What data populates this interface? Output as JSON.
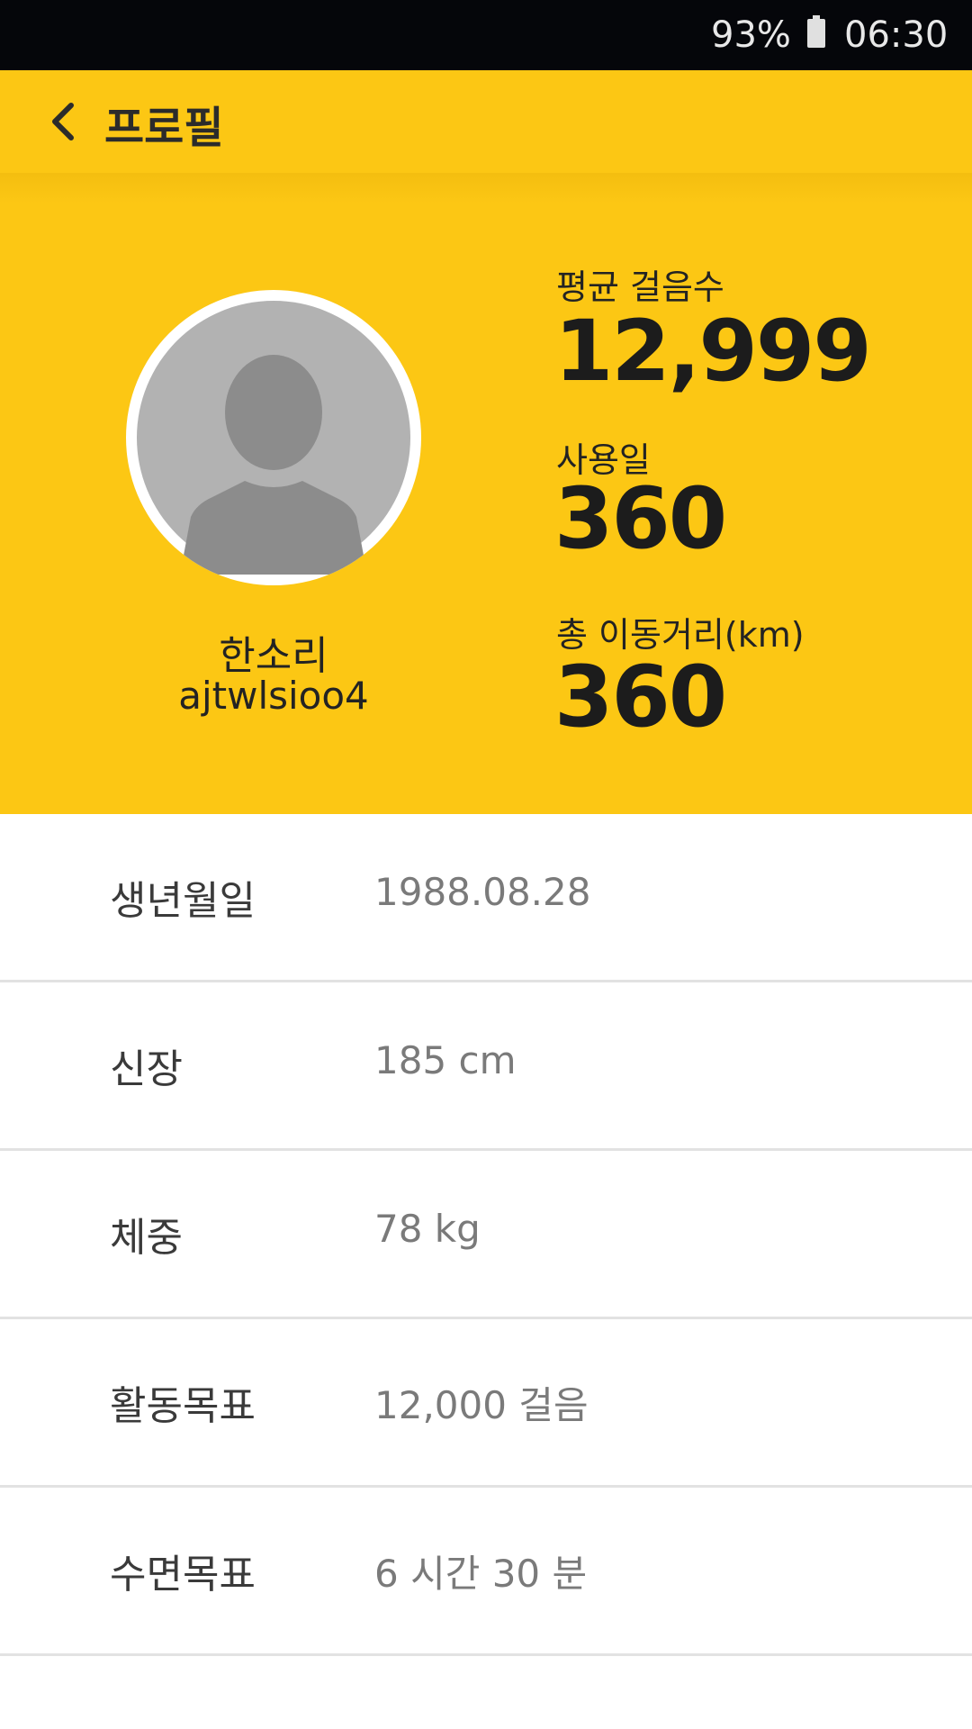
{
  "status_bar": {
    "battery": "93%",
    "battery_icon": "battery-icon",
    "time": "06:30"
  },
  "app_bar": {
    "back_icon": "chevron-left-icon",
    "title": "프로필"
  },
  "colors": {
    "accent": "#fcc714",
    "status_bar": "#05060a",
    "divider": "#e2e2e2"
  },
  "profile": {
    "avatar_icon": "default-avatar-icon",
    "name": "한소리",
    "user_id": "ajtwlsioo4"
  },
  "stats": [
    {
      "label": "평균 걸음수",
      "value": "12,999"
    },
    {
      "label": "사용일",
      "value": "360"
    },
    {
      "label": "총 이동거리(km)",
      "value": "360"
    }
  ],
  "info": [
    {
      "label": "생년월일",
      "value": "1988.08.28"
    },
    {
      "label": "신장",
      "value": "185 cm"
    },
    {
      "label": "체중",
      "value": "78 kg"
    },
    {
      "label": "활동목표",
      "value": "12,000 걸음"
    },
    {
      "label": "수면목표",
      "value": "6 시간 30 분"
    }
  ]
}
